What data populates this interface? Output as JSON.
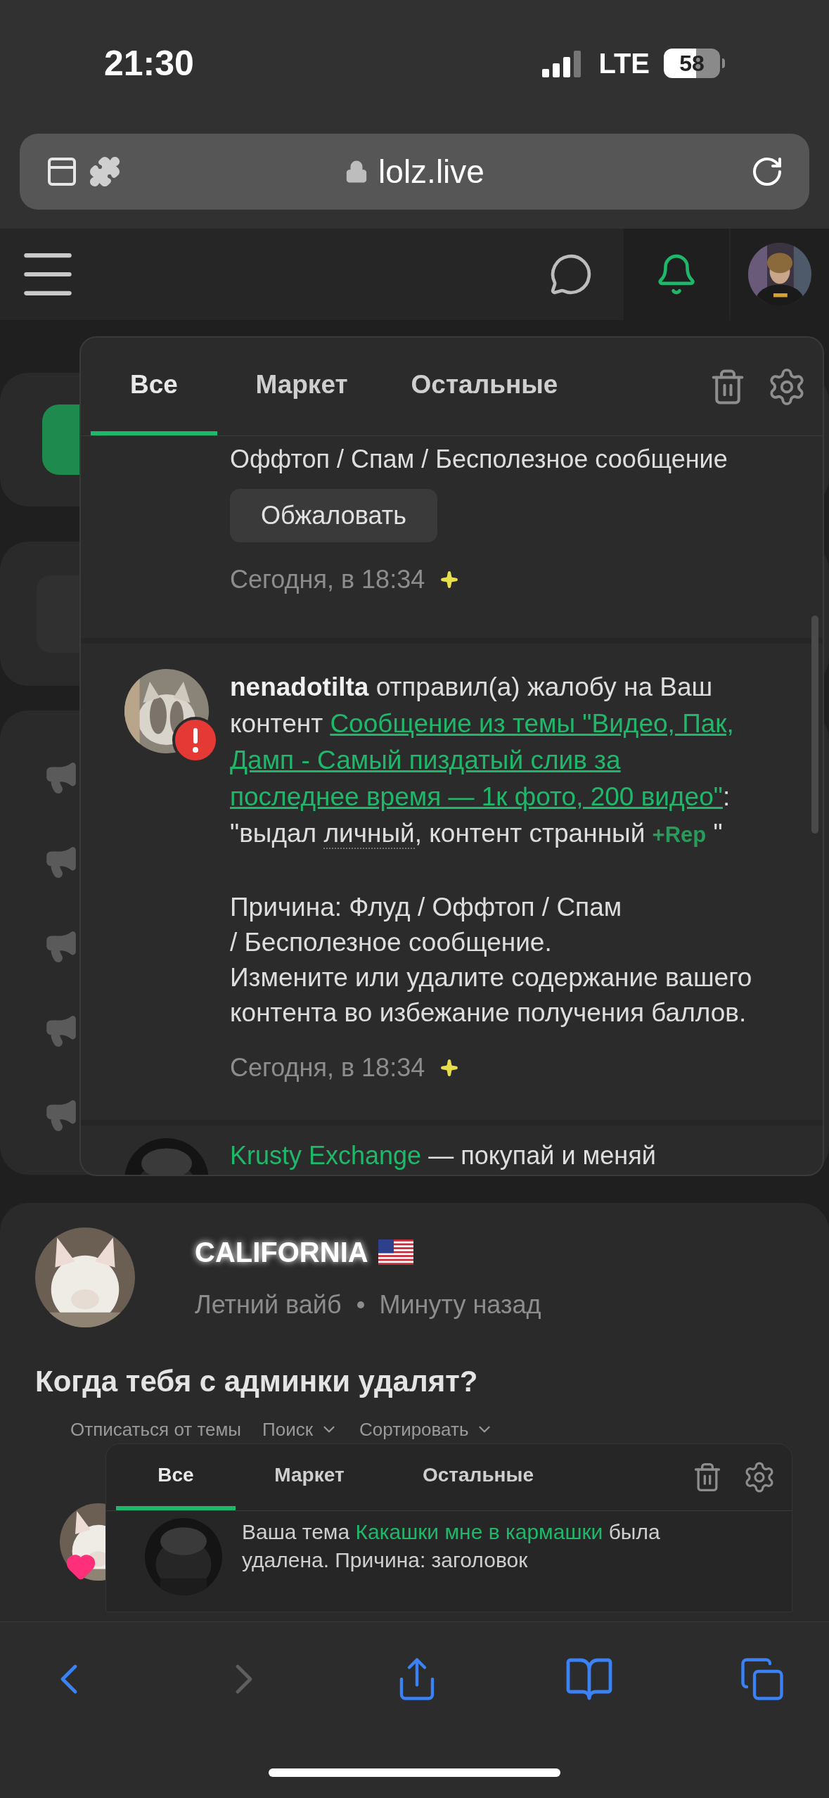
{
  "status_bar": {
    "time": "21:30",
    "network": "LTE",
    "battery": "58"
  },
  "address_bar": {
    "url": "lolz.live"
  },
  "header": {
    "nav": [
      {
        "kind": "chat",
        "selected": false
      },
      {
        "kind": "bell",
        "selected": true
      }
    ]
  },
  "notifications_popup": {
    "tabs": [
      {
        "label": "Все",
        "selected": true
      },
      {
        "label": "Маркет",
        "selected": false
      },
      {
        "label": "Остальные",
        "selected": false
      }
    ],
    "items": [
      {
        "kind": "partial",
        "text": "Оффтоп / Спам / Бесполезное сообщение",
        "button": "Обжаловать",
        "time": "Сегодня, в 18:34"
      },
      {
        "kind": "report",
        "user": "nenadotilta",
        "action": "отправил(а) жалобу на Ваш",
        "action_2": "контент",
        "link_lines": [
          "Сообщение из темы \"Видео, Пак,",
          "Дамп - Самый пиздатый слив за",
          "последнее время — 1к фото, 200 видео\""
        ],
        "after_link": ":",
        "quote_start": "\"выдал",
        "quote_word": "личный",
        "quote_rest": ", контент странный",
        "rep": "+Rep",
        "quote_end": "\"",
        "reason": "Причина: Флуд / Оффтоп / Спам / Бесполезное сообщение.",
        "advice": "Измените или удалите содержание вашего контента во избежание получения баллов.",
        "time": "Сегодня, в 18:34"
      },
      {
        "kind": "ad",
        "link": "Krusty Exchange",
        "text": "— покупай и меняй"
      }
    ]
  },
  "post": {
    "author": "CALIFORNIA",
    "status": "Летний вайб",
    "time": "Минуту назад",
    "title": "Когда тебя с админки удалят?",
    "screenshot": {
      "toolbar": [
        "Отписаться от темы",
        "Поиск",
        "Сортировать"
      ],
      "tabs": [
        {
          "label": "Все",
          "selected": true
        },
        {
          "label": "Маркет",
          "selected": false
        },
        {
          "label": "Остальные",
          "selected": false
        }
      ],
      "item": {
        "prefix": "Ваша тема",
        "link": "Какашки мне в кармашки",
        "text": "была удалена. Причина: заголовок"
      }
    }
  },
  "browser_toolbar": {
    "back_disabled": false,
    "forward_disabled": true
  }
}
